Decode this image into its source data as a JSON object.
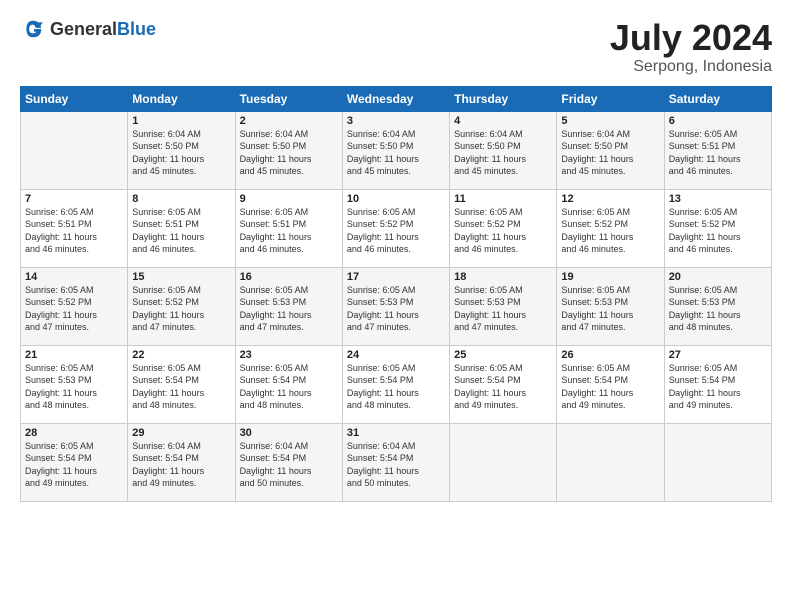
{
  "header": {
    "logo_general": "General",
    "logo_blue": "Blue",
    "month_year": "July 2024",
    "location": "Serpong, Indonesia"
  },
  "days_of_week": [
    "Sunday",
    "Monday",
    "Tuesday",
    "Wednesday",
    "Thursday",
    "Friday",
    "Saturday"
  ],
  "weeks": [
    [
      {
        "day": "",
        "info": ""
      },
      {
        "day": "1",
        "info": "Sunrise: 6:04 AM\nSunset: 5:50 PM\nDaylight: 11 hours\nand 45 minutes."
      },
      {
        "day": "2",
        "info": "Sunrise: 6:04 AM\nSunset: 5:50 PM\nDaylight: 11 hours\nand 45 minutes."
      },
      {
        "day": "3",
        "info": "Sunrise: 6:04 AM\nSunset: 5:50 PM\nDaylight: 11 hours\nand 45 minutes."
      },
      {
        "day": "4",
        "info": "Sunrise: 6:04 AM\nSunset: 5:50 PM\nDaylight: 11 hours\nand 45 minutes."
      },
      {
        "day": "5",
        "info": "Sunrise: 6:04 AM\nSunset: 5:50 PM\nDaylight: 11 hours\nand 45 minutes."
      },
      {
        "day": "6",
        "info": "Sunrise: 6:05 AM\nSunset: 5:51 PM\nDaylight: 11 hours\nand 46 minutes."
      }
    ],
    [
      {
        "day": "7",
        "info": "Sunrise: 6:05 AM\nSunset: 5:51 PM\nDaylight: 11 hours\nand 46 minutes."
      },
      {
        "day": "8",
        "info": "Sunrise: 6:05 AM\nSunset: 5:51 PM\nDaylight: 11 hours\nand 46 minutes."
      },
      {
        "day": "9",
        "info": "Sunrise: 6:05 AM\nSunset: 5:51 PM\nDaylight: 11 hours\nand 46 minutes."
      },
      {
        "day": "10",
        "info": "Sunrise: 6:05 AM\nSunset: 5:52 PM\nDaylight: 11 hours\nand 46 minutes."
      },
      {
        "day": "11",
        "info": "Sunrise: 6:05 AM\nSunset: 5:52 PM\nDaylight: 11 hours\nand 46 minutes."
      },
      {
        "day": "12",
        "info": "Sunrise: 6:05 AM\nSunset: 5:52 PM\nDaylight: 11 hours\nand 46 minutes."
      },
      {
        "day": "13",
        "info": "Sunrise: 6:05 AM\nSunset: 5:52 PM\nDaylight: 11 hours\nand 46 minutes."
      }
    ],
    [
      {
        "day": "14",
        "info": "Sunrise: 6:05 AM\nSunset: 5:52 PM\nDaylight: 11 hours\nand 47 minutes."
      },
      {
        "day": "15",
        "info": "Sunrise: 6:05 AM\nSunset: 5:52 PM\nDaylight: 11 hours\nand 47 minutes."
      },
      {
        "day": "16",
        "info": "Sunrise: 6:05 AM\nSunset: 5:53 PM\nDaylight: 11 hours\nand 47 minutes."
      },
      {
        "day": "17",
        "info": "Sunrise: 6:05 AM\nSunset: 5:53 PM\nDaylight: 11 hours\nand 47 minutes."
      },
      {
        "day": "18",
        "info": "Sunrise: 6:05 AM\nSunset: 5:53 PM\nDaylight: 11 hours\nand 47 minutes."
      },
      {
        "day": "19",
        "info": "Sunrise: 6:05 AM\nSunset: 5:53 PM\nDaylight: 11 hours\nand 47 minutes."
      },
      {
        "day": "20",
        "info": "Sunrise: 6:05 AM\nSunset: 5:53 PM\nDaylight: 11 hours\nand 48 minutes."
      }
    ],
    [
      {
        "day": "21",
        "info": "Sunrise: 6:05 AM\nSunset: 5:53 PM\nDaylight: 11 hours\nand 48 minutes."
      },
      {
        "day": "22",
        "info": "Sunrise: 6:05 AM\nSunset: 5:54 PM\nDaylight: 11 hours\nand 48 minutes."
      },
      {
        "day": "23",
        "info": "Sunrise: 6:05 AM\nSunset: 5:54 PM\nDaylight: 11 hours\nand 48 minutes."
      },
      {
        "day": "24",
        "info": "Sunrise: 6:05 AM\nSunset: 5:54 PM\nDaylight: 11 hours\nand 48 minutes."
      },
      {
        "day": "25",
        "info": "Sunrise: 6:05 AM\nSunset: 5:54 PM\nDaylight: 11 hours\nand 49 minutes."
      },
      {
        "day": "26",
        "info": "Sunrise: 6:05 AM\nSunset: 5:54 PM\nDaylight: 11 hours\nand 49 minutes."
      },
      {
        "day": "27",
        "info": "Sunrise: 6:05 AM\nSunset: 5:54 PM\nDaylight: 11 hours\nand 49 minutes."
      }
    ],
    [
      {
        "day": "28",
        "info": "Sunrise: 6:05 AM\nSunset: 5:54 PM\nDaylight: 11 hours\nand 49 minutes."
      },
      {
        "day": "29",
        "info": "Sunrise: 6:04 AM\nSunset: 5:54 PM\nDaylight: 11 hours\nand 49 minutes."
      },
      {
        "day": "30",
        "info": "Sunrise: 6:04 AM\nSunset: 5:54 PM\nDaylight: 11 hours\nand 50 minutes."
      },
      {
        "day": "31",
        "info": "Sunrise: 6:04 AM\nSunset: 5:54 PM\nDaylight: 11 hours\nand 50 minutes."
      },
      {
        "day": "",
        "info": ""
      },
      {
        "day": "",
        "info": ""
      },
      {
        "day": "",
        "info": ""
      }
    ]
  ]
}
